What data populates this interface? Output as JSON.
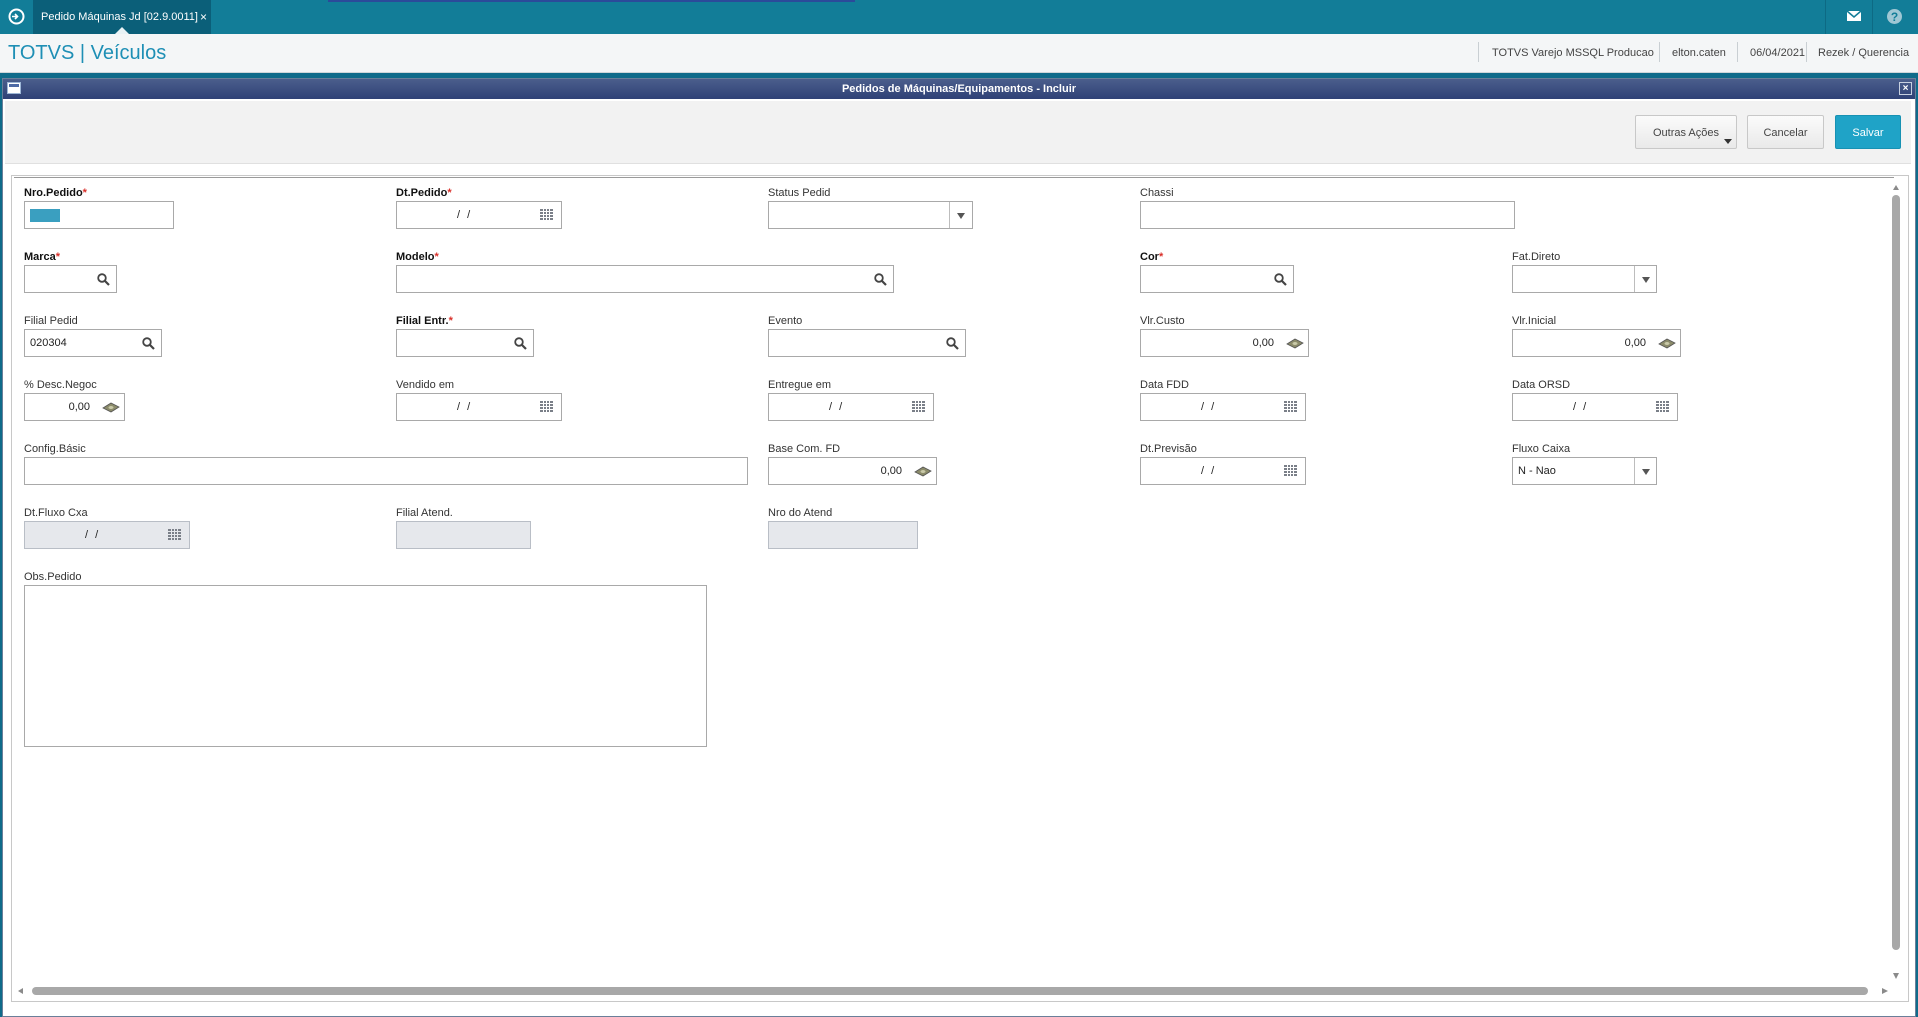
{
  "tab": {
    "title": "Pedido Máquinas Jd [02.9.0011]",
    "close": "×"
  },
  "header": {
    "brand": "TOTVS | Veículos",
    "environment": "TOTVS Varejo MSSQL Producao",
    "user": "elton.caten",
    "date": "06/04/2021",
    "branch": "Rezek / Querencia"
  },
  "dialog": {
    "title": "Pedidos de Máquinas/Equipamentos - Incluir",
    "close": "×"
  },
  "toolbar": {
    "other_actions": "Outras Ações",
    "cancel": "Cancelar",
    "save": "Salvar"
  },
  "fields": {
    "nro_pedido": {
      "label": "Nro.Pedido",
      "required": "*"
    },
    "dt_pedido": {
      "label": "Dt.Pedido",
      "required": "*",
      "value": "/ /"
    },
    "status_pedid": {
      "label": "Status Pedid",
      "value": ""
    },
    "chassi": {
      "label": "Chassi",
      "value": ""
    },
    "marca": {
      "label": "Marca",
      "required": "*"
    },
    "modelo": {
      "label": "Modelo",
      "required": "*"
    },
    "cor": {
      "label": "Cor",
      "required": "*"
    },
    "fat_direto": {
      "label": "Fat.Direto",
      "value": ""
    },
    "filial_pedid": {
      "label": "Filial Pedid",
      "value": "020304"
    },
    "filial_entr": {
      "label": "Filial Entr.",
      "required": "*"
    },
    "evento": {
      "label": "Evento"
    },
    "vlr_custo": {
      "label": "Vlr.Custo",
      "value": "0,00"
    },
    "vlr_inicial": {
      "label": "Vlr.Inicial",
      "value": "0,00"
    },
    "desc_negoc": {
      "label": "% Desc.Negoc",
      "value": "0,00"
    },
    "vendido_em": {
      "label": "Vendido em",
      "value": "/ /"
    },
    "entregue_em": {
      "label": "Entregue em",
      "value": "/ /"
    },
    "data_fdd": {
      "label": "Data FDD",
      "value": "/ /"
    },
    "data_orsd": {
      "label": "Data ORSD",
      "value": "/ /"
    },
    "config_basic": {
      "label": "Config.Básic"
    },
    "base_com_fd": {
      "label": "Base Com. FD",
      "value": "0,00"
    },
    "dt_previsao": {
      "label": "Dt.Previsão",
      "value": "/ /"
    },
    "fluxo_caixa": {
      "label": "Fluxo Caixa",
      "value": "N - Nao"
    },
    "dt_fluxo_cxa": {
      "label": "Dt.Fluxo Cxa",
      "value": "/ /"
    },
    "filial_atend": {
      "label": "Filial Atend."
    },
    "nro_do_atend": {
      "label": "Nro do Atend"
    },
    "obs_pedido": {
      "label": "Obs.Pedido"
    }
  },
  "colors": {
    "accent": "#1fa3c7",
    "topbar": "#127d98",
    "title_bar": "#3a4c80",
    "required": "#d9302a"
  },
  "icons": [
    "app-logo-icon",
    "mail-icon",
    "help-icon",
    "window-icon",
    "search-icon",
    "calendar-icon",
    "money-icon",
    "chevron-down-icon"
  ]
}
